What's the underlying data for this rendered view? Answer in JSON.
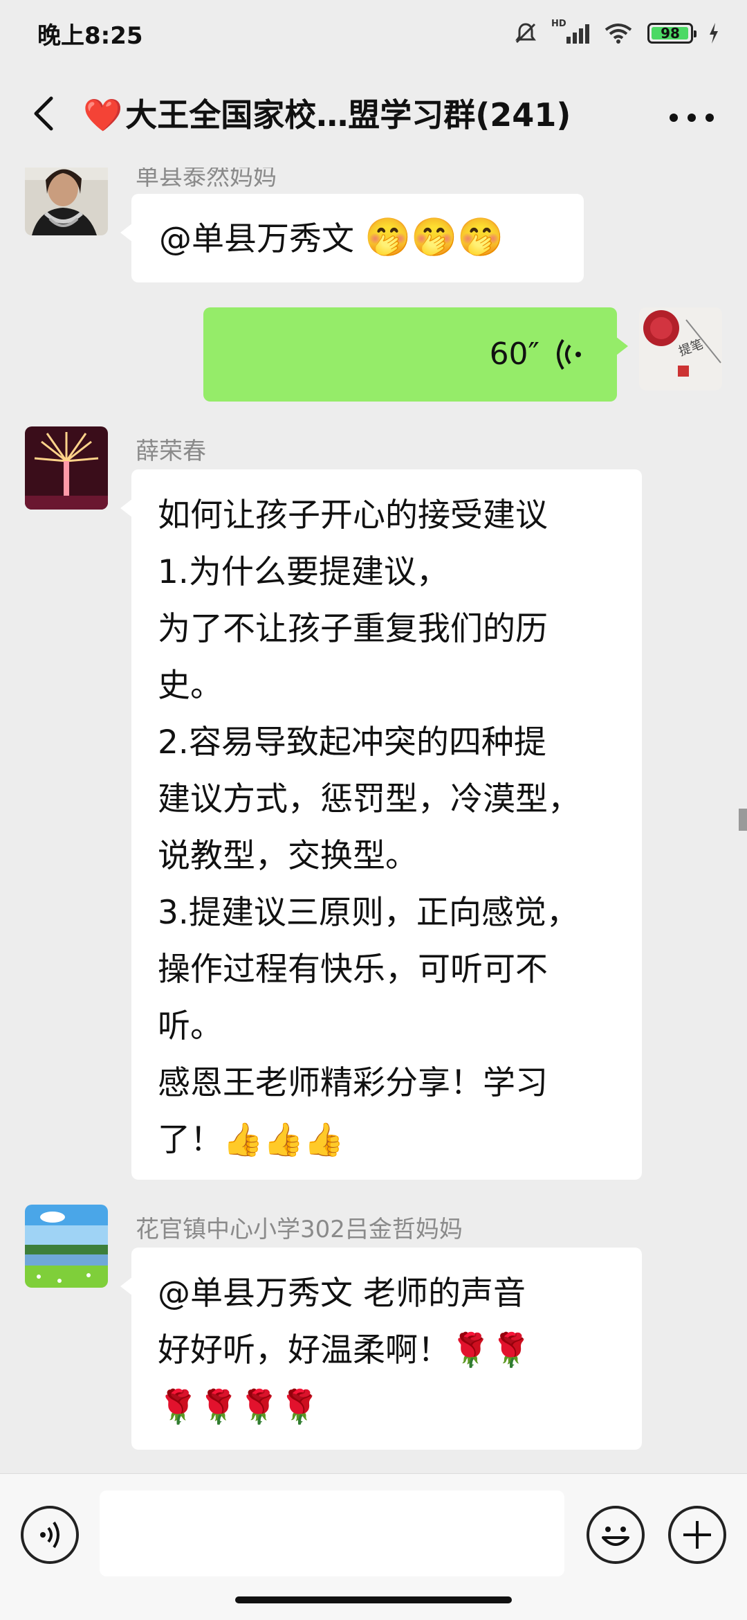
{
  "status": {
    "time": "晚上8:25",
    "network": "HD",
    "battery": "98",
    "battery_level": 0.98
  },
  "header": {
    "title_prefix": "❤️",
    "title": "大王全国家校…盟学习群(241)",
    "back_icon": "chevron-left-icon",
    "more_icon": "more-dots-icon"
  },
  "messages": [
    {
      "sender": "单县泰然妈妈",
      "lines": [
        "@单县万秀文 ",
        "🤭🤭🤭"
      ],
      "avatar": "woman-portrait"
    },
    {
      "self": true,
      "duration": "60″",
      "avatar": "calligraphy-photo"
    },
    {
      "sender": "薛荣春",
      "lines": [
        "如何让孩子开心的接受建议",
        "1.为什么要提建议，",
        "为了不让孩子重复我们的历",
        "史。",
        "2.容易导致起冲突的四种提",
        "建议方式，惩罚型，冷漠型，",
        "说教型，交换型。",
        "3.提建议三原则，正向感觉，",
        "操作过程有快乐，可听可不",
        "听。",
        "感恩王老师精彩分享！学习",
        "了！👍👍👍"
      ],
      "avatar": "fireworks-photo"
    },
    {
      "sender": "花官镇中心小学302吕金哲妈妈",
      "lines": [
        "@单县万秀文  老师的声音",
        "好好听，好温柔啊！🌹🌹",
        "🌹🌹🌹🌹"
      ],
      "avatar": "landscape-photo"
    }
  ],
  "input": {
    "placeholder": "",
    "voice_icon": "voice-toggle-icon",
    "emoji_icon": "smiley-icon",
    "plus_icon": "plus-icon"
  }
}
